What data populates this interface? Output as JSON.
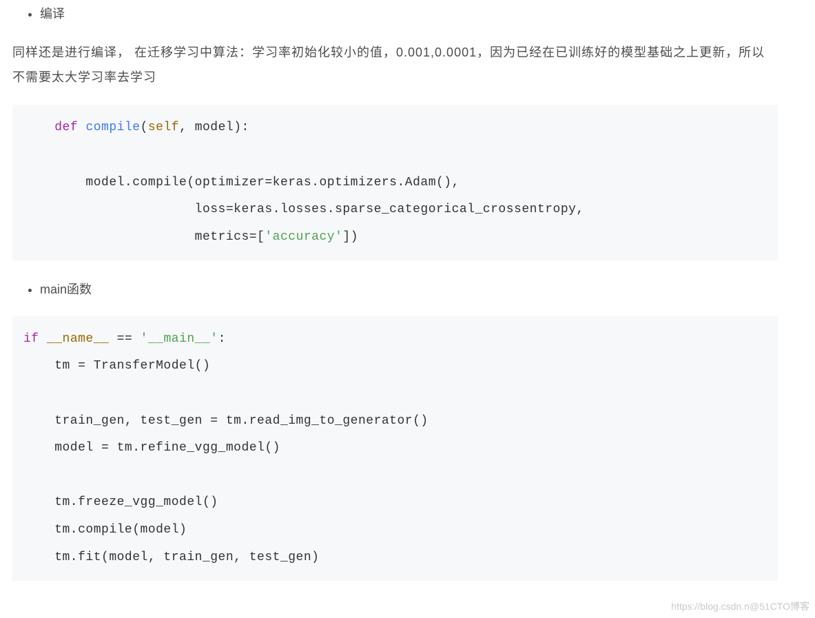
{
  "bullets": {
    "compile": "编译",
    "main": "main函数"
  },
  "paragraphs": {
    "p1": "同样还是进行编译， 在迁移学习中算法：学习率初始化较小的值，0.001,0.0001，因为已经在已训练好的模型基础之上更新，所以不需要太大学习率去学习"
  },
  "code1": {
    "kw_def": "def",
    "fn_compile": "compile",
    "self1": "self",
    "after_lparen": "(",
    "comma_model": ", model):",
    "line2": "        model.compile(optimizer=keras.optimizers.Adam(),",
    "line3": "                      loss=keras.losses.sparse_categorical_crossentropy,",
    "line4_pre": "                      metrics=[",
    "str_acc": "'accuracy'",
    "line4_post": "])"
  },
  "code2": {
    "kw_if": "if",
    "name_dunder": "__name__",
    "eq": " == ",
    "str_main": "'__main__'",
    "colon": ":",
    "l2": "    tm = TransferModel()",
    "l3": "    train_gen, test_gen = tm.read_img_to_generator()",
    "l4": "    model = tm.refine_vgg_model()",
    "l5": "    tm.freeze_vgg_model()",
    "l6": "    tm.compile(model)",
    "l7": "    tm.fit(model, train_gen, test_gen)"
  },
  "watermark": "https://blog.csdn.n@51CTO博客"
}
